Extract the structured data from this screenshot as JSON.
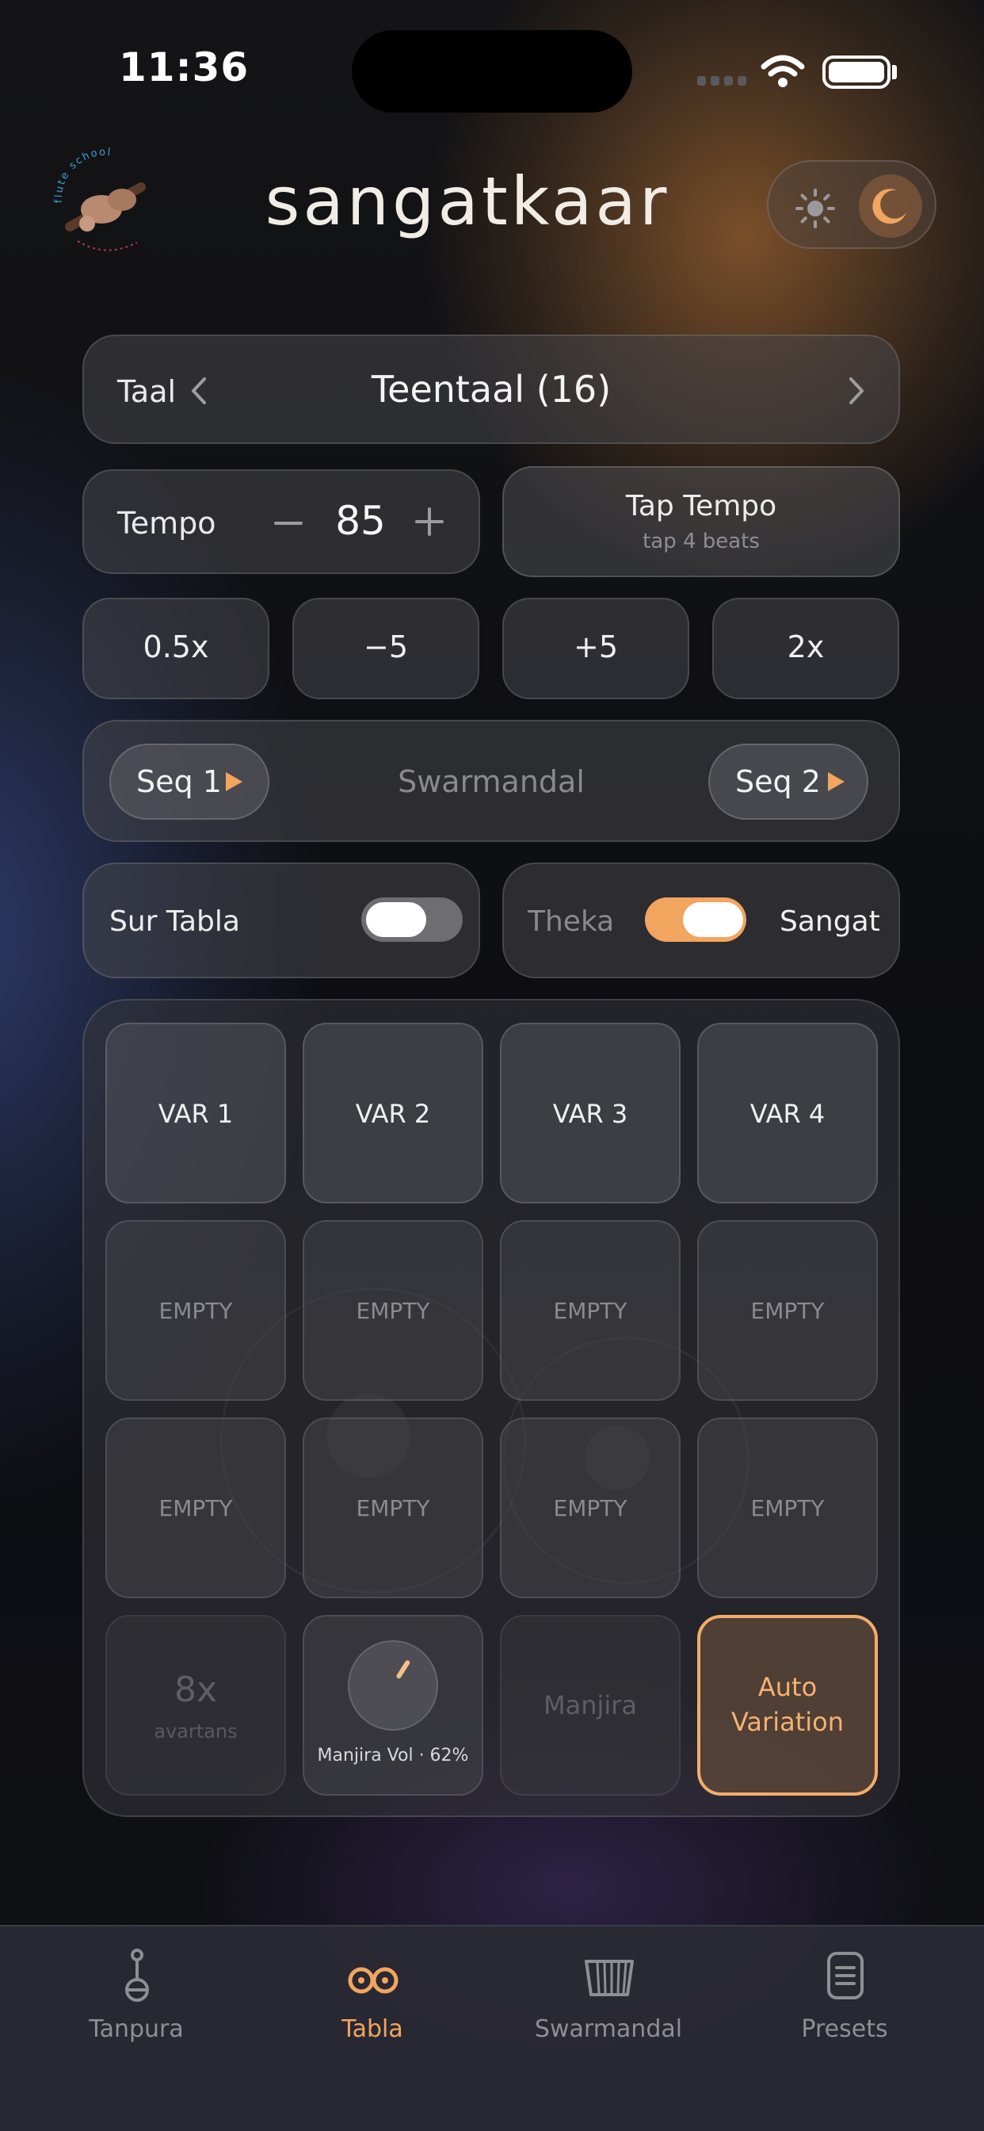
{
  "status_bar": {
    "time": "11:36"
  },
  "header": {
    "title": "sangatkaar",
    "logo_text": "flute school"
  },
  "taal": {
    "label": "Taal",
    "value": "Teentaal (16)"
  },
  "tempo": {
    "label": "Tempo",
    "value": "85",
    "minus": "−",
    "plus": "+"
  },
  "tap_tempo": {
    "title": "Tap Tempo",
    "subtitle": "tap 4 beats"
  },
  "multipliers": [
    "0.5x",
    "−5",
    "+5",
    "2x"
  ],
  "sequence": {
    "seq1": "Seq 1",
    "seq2": "Seq 2",
    "center": "Swarmandal"
  },
  "sur_tabla": {
    "label": "Sur Tabla",
    "on": false
  },
  "mode_toggle": {
    "left": "Theka",
    "right": "Sangat",
    "on": true
  },
  "pads": {
    "row1": [
      "VAR 1",
      "VAR 2",
      "VAR 3",
      "VAR 4"
    ],
    "row2": [
      "EMPTY",
      "EMPTY",
      "EMPTY",
      "EMPTY"
    ],
    "row3": [
      "EMPTY",
      "EMPTY",
      "EMPTY",
      "EMPTY"
    ],
    "avartans_value": "8x",
    "avartans_label": "avartans",
    "manjira_vol_caption": "Manjira Vol · 62%",
    "manjira_vol": 0.62,
    "manjira": "Manjira",
    "auto_variation_line1": "Auto",
    "auto_variation_line2": "Variation"
  },
  "tabs": [
    {
      "label": "Tanpura",
      "icon": "tanpura-icon",
      "active": false
    },
    {
      "label": "Tabla",
      "icon": "tabla-icon",
      "active": true
    },
    {
      "label": "Swarmandal",
      "icon": "swarmandal-icon",
      "active": false
    },
    {
      "label": "Presets",
      "icon": "presets-icon",
      "active": false
    }
  ],
  "colors": {
    "accent": "#f2a55e",
    "background": "#0f1014"
  }
}
